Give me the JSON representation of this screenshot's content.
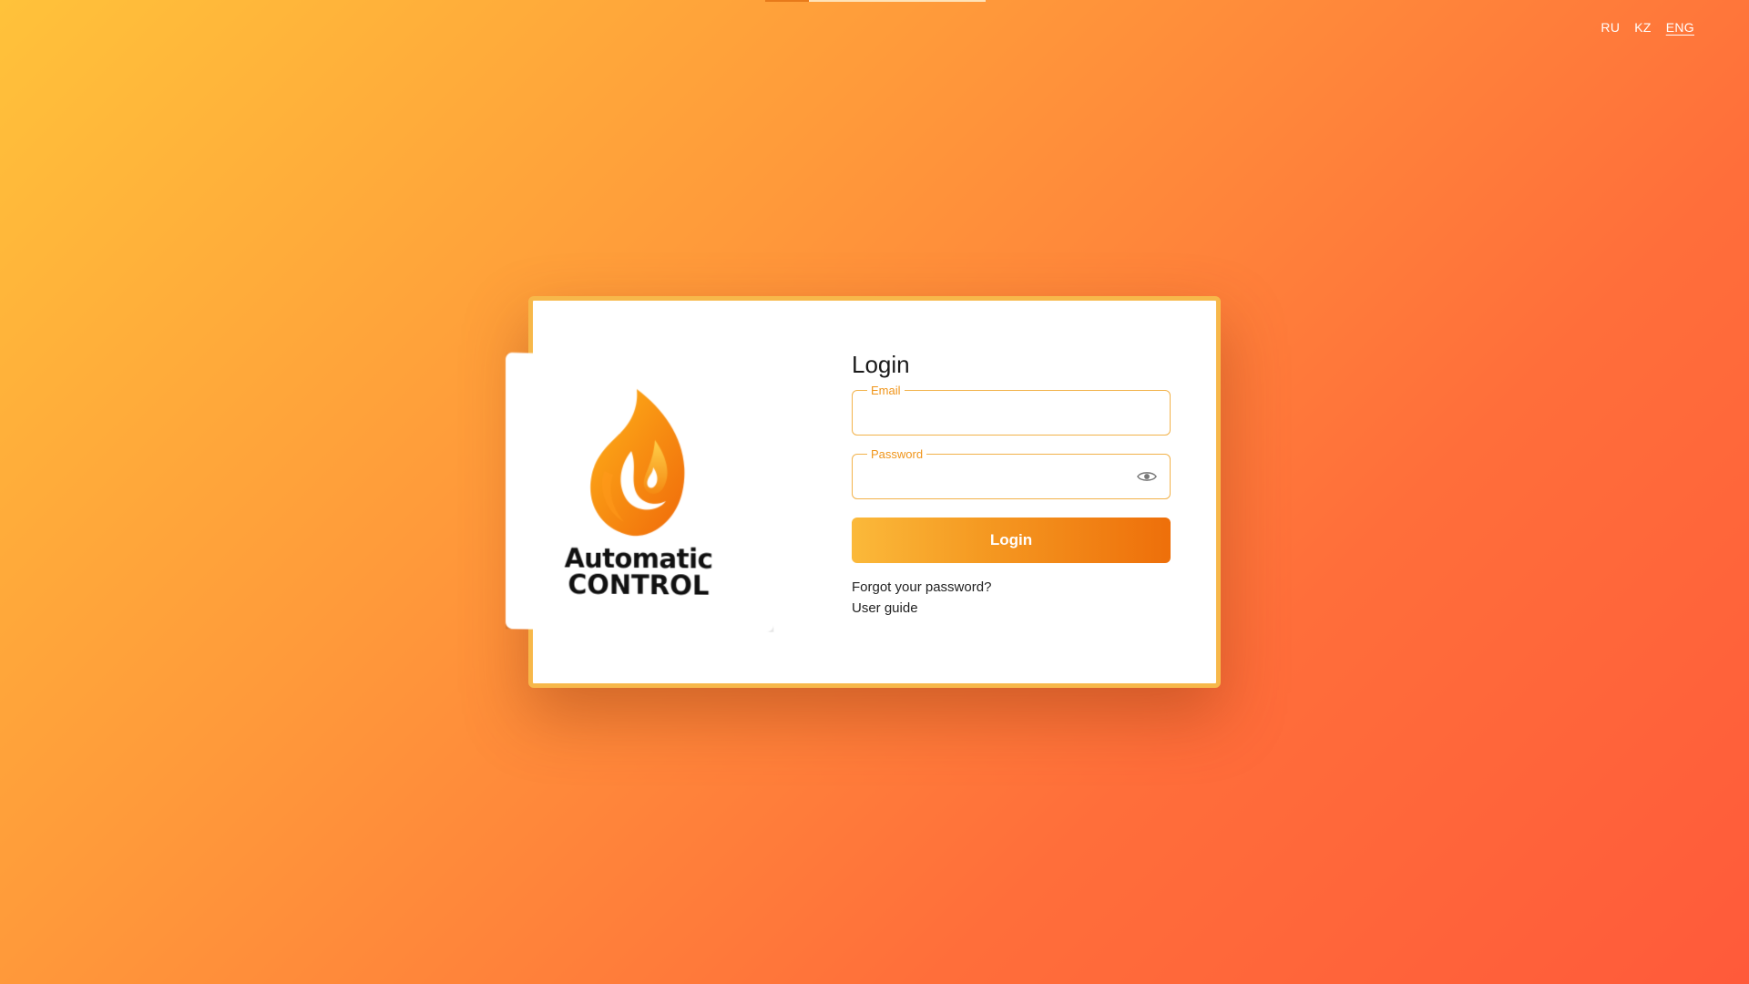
{
  "languages": [
    {
      "label": "RU",
      "active": false
    },
    {
      "label": "KZ",
      "active": false
    },
    {
      "label": "ENG",
      "active": true
    }
  ],
  "brand": {
    "line1": "Automatic",
    "line2": "CONTROL",
    "logo_icon": "flame-icon"
  },
  "form": {
    "title": "Login",
    "email": {
      "label": "Email",
      "value": "",
      "placeholder": ""
    },
    "password": {
      "label": "Password",
      "value": "",
      "placeholder": "",
      "toggle_icon": "eye-icon"
    },
    "submit_label": "Login",
    "forgot_link": "Forgot your password?",
    "guide_link": "User guide"
  },
  "colors": {
    "accent": "#f59a22",
    "border": "#f2b24a",
    "background_start": "#ffc23a",
    "background_end": "#ff5a3a"
  }
}
